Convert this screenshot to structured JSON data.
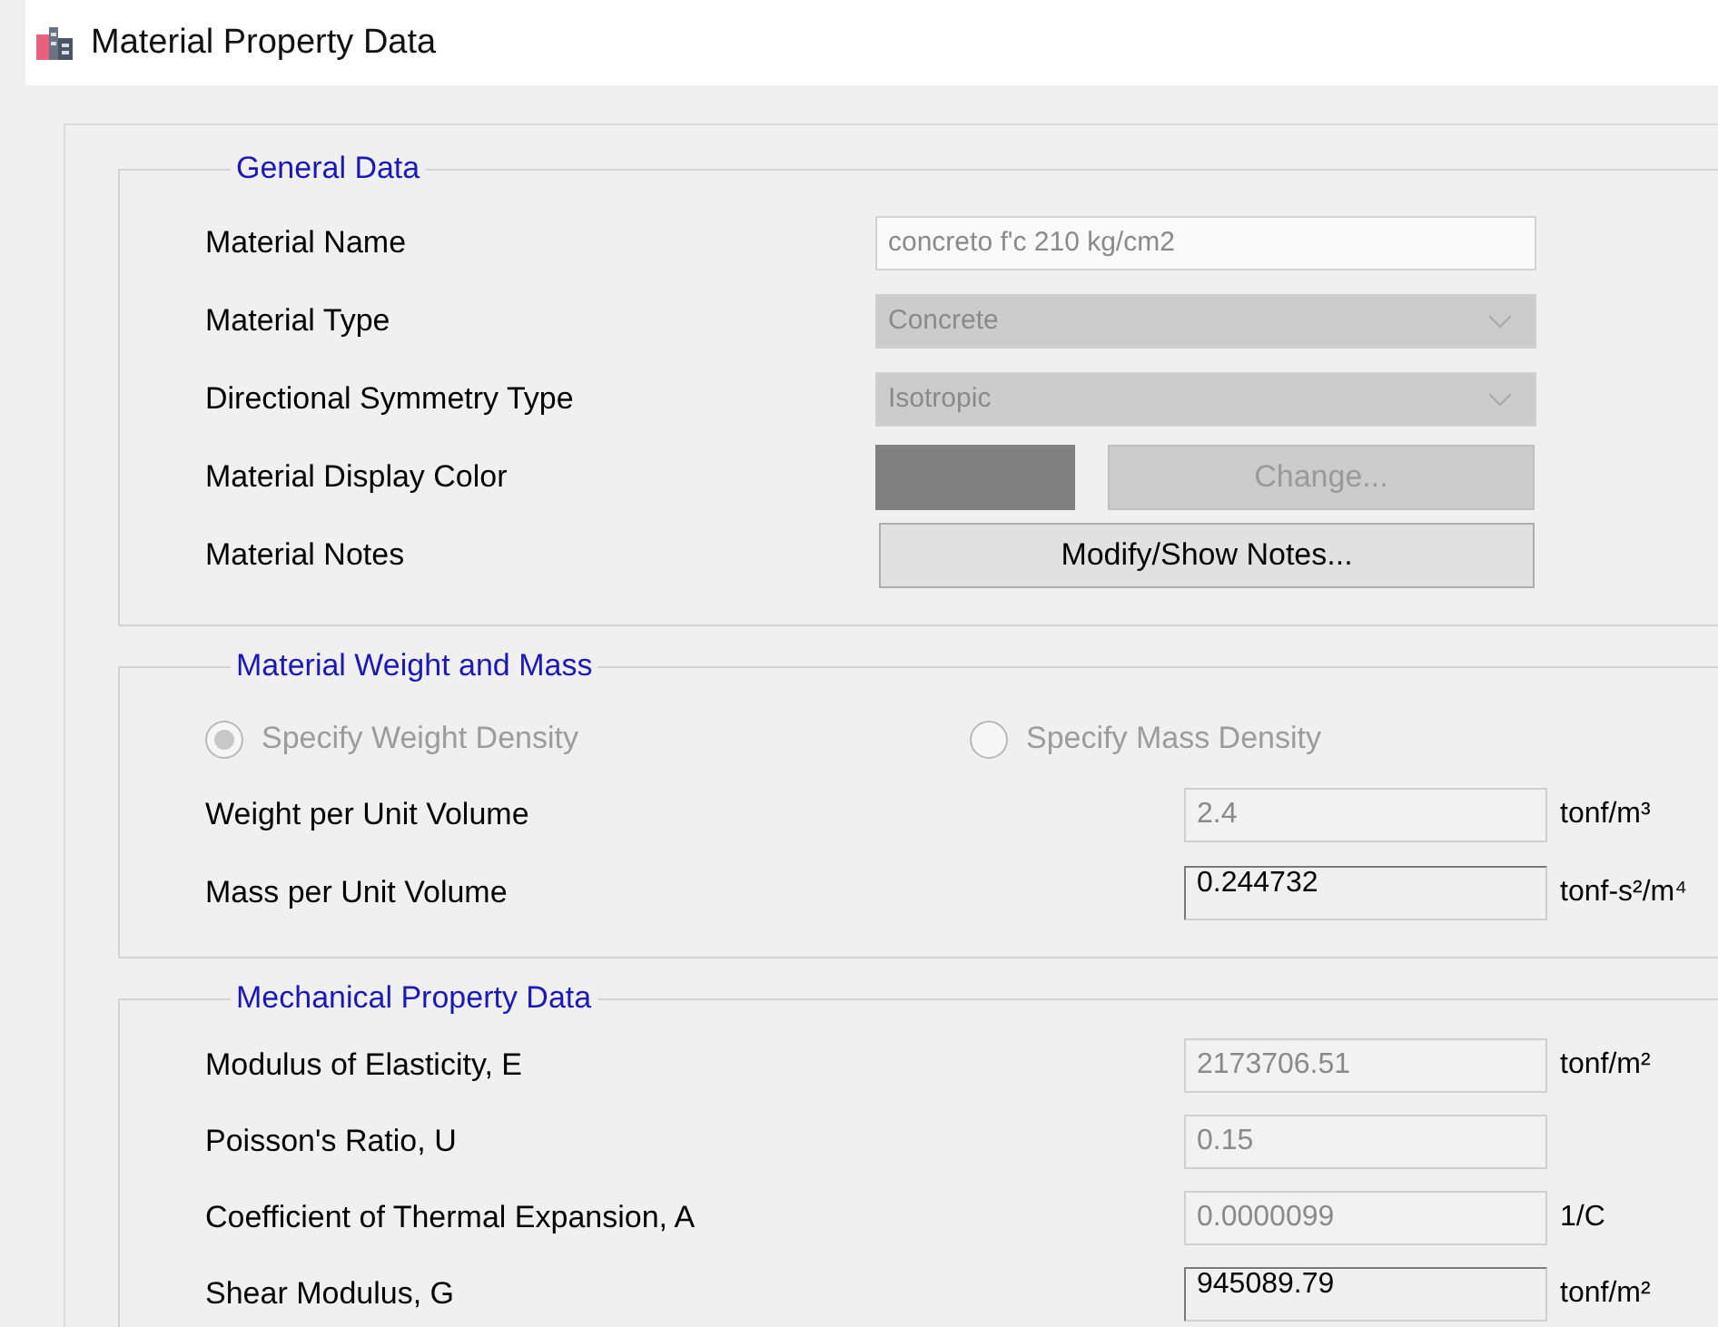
{
  "window": {
    "title": "Material Property Data"
  },
  "general_data": {
    "title": "General Data",
    "rows": [
      {
        "kind": "text",
        "label": "Material Name",
        "value": "concreto f'c 210 kg/cm2",
        "disabled": true
      },
      {
        "kind": "dropdown",
        "label": "Material Type",
        "value": "Concrete",
        "disabled": true
      },
      {
        "kind": "dropdown",
        "label": "Directional Symmetry Type",
        "value": "Isotropic",
        "disabled": true
      },
      {
        "kind": "color",
        "label": "Material Display Color",
        "color": "#808080",
        "button": "Change...",
        "disabled": true
      },
      {
        "kind": "button",
        "label": "Material Notes",
        "button": "Modify/Show Notes...",
        "disabled": false
      }
    ]
  },
  "weight_and_mass": {
    "title": "Material Weight and Mass",
    "options": [
      {
        "label": "Specify Weight Density",
        "selected": true,
        "disabled": true
      },
      {
        "label": "Specify Mass Density",
        "selected": false,
        "disabled": true
      }
    ],
    "rows": [
      {
        "label": "Weight per Unit Volume",
        "value": "2.4",
        "unit": "tonf/m³",
        "disabled": true
      },
      {
        "label": "Mass per Unit Volume",
        "value": "0.244732",
        "unit": "tonf-s²/m⁴",
        "disabled": false
      }
    ]
  },
  "mechanical_property_data": {
    "title": "Mechanical Property Data",
    "rows": [
      {
        "label": "Modulus of Elasticity,  E",
        "value": "2173706.51",
        "unit": "tonf/m²",
        "disabled": true
      },
      {
        "label": "Poisson's Ratio,  U",
        "value": "0.15",
        "disabled": true
      },
      {
        "label": "Coefficient of Thermal Expansion,  A",
        "value": "0.0000099",
        "unit": "1/C",
        "disabled": true
      },
      {
        "label": "Shear Modulus,  G",
        "value": "945089.79",
        "unit": "tonf/m²",
        "disabled": false
      }
    ]
  }
}
